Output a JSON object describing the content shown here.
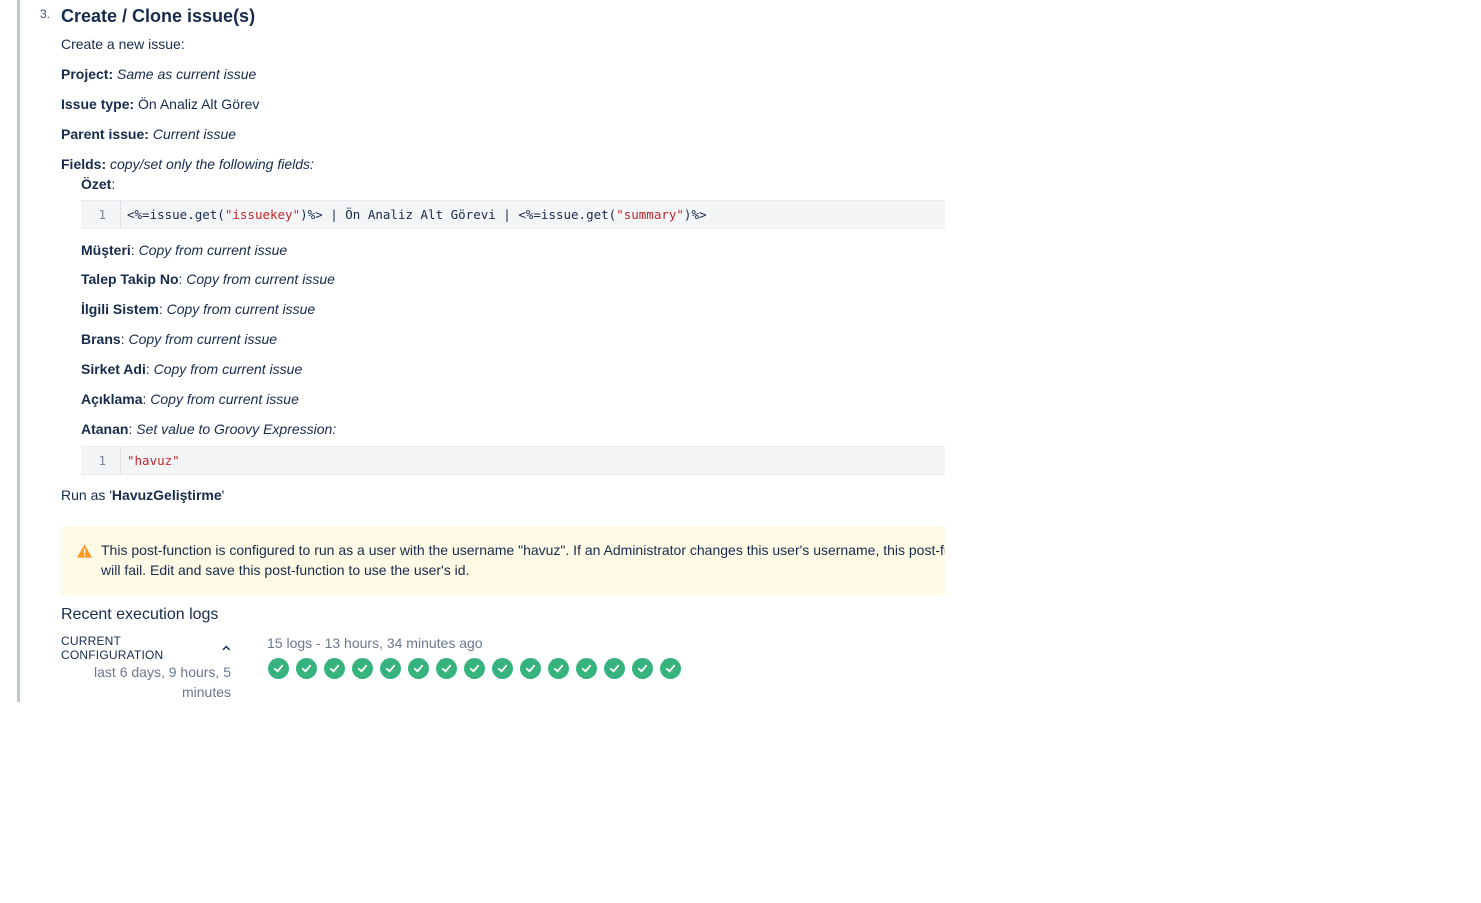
{
  "step": {
    "number": "3.",
    "title": "Create / Clone issue(s)"
  },
  "intro": "Create a new issue:",
  "project": {
    "label": "Project:",
    "value": "Same as current issue"
  },
  "issue_type": {
    "label": "Issue type:",
    "value": "Ön Analiz Alt Görev"
  },
  "parent_issue": {
    "label": "Parent issue:",
    "value": "Current issue"
  },
  "fields_header": {
    "label": "Fields:",
    "value": "copy/set only the following fields:"
  },
  "fields": {
    "ozet": {
      "name": "Özet",
      "sep": ":"
    },
    "ozet_code": {
      "line_no": "1",
      "part1": "<%=issue.get(",
      "str1": "\"issuekey\"",
      "part2": ")%> | Ön Analiz Alt Görevi | <%=issue.get(",
      "str2": "\"summary\"",
      "part3": ")%>"
    },
    "musteri": {
      "name": "Müşteri",
      "value": "Copy from current issue"
    },
    "talep": {
      "name": "Talep Takip No",
      "value": "Copy from current issue"
    },
    "ilgili": {
      "name": "İlgili Sistem",
      "value": "Copy from current issue"
    },
    "brans": {
      "name": "Brans",
      "value": "Copy from current issue"
    },
    "sirket": {
      "name": "Sirket Adi",
      "value": "Copy from current issue"
    },
    "aciklama": {
      "name": "Açıklama",
      "value": "Copy from current issue"
    },
    "atanan": {
      "name": "Atanan",
      "value": "Set value to Groovy Expression:"
    },
    "atanan_code": {
      "line_no": "1",
      "str": "\"havuz\""
    }
  },
  "run_as": {
    "prefix": "Run as '",
    "user": "HavuzGeliştirme",
    "suffix": "'"
  },
  "warning": {
    "text": "This post-function is configured to run as a user with the username \"havuz\". If an Administrator changes this user's username, this post-function will fail. Edit and save this post-function to use the user's id.",
    "color": "#fffae6",
    "icon": "warning-icon"
  },
  "logs": {
    "heading": "Recent execution logs",
    "config_label": "CURRENT CONFIGURATION",
    "config_time": "last 6 days, 9 hours, 5 minutes",
    "summary": "15 logs - 13 hours, 34 minutes ago",
    "success_count": 15,
    "success_color": "#36b37e"
  }
}
